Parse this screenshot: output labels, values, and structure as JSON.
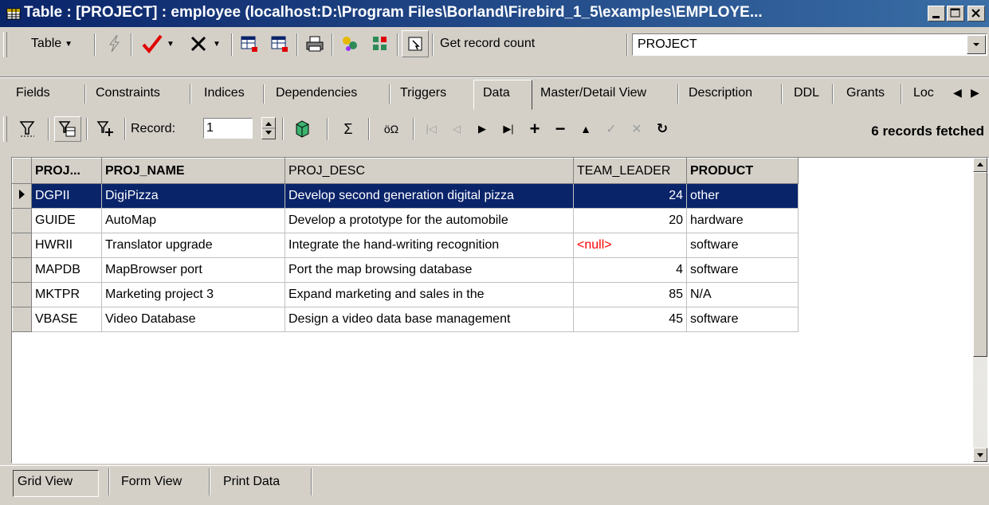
{
  "window": {
    "title": "Table : [PROJECT] : employee (localhost:D:\\Program Files\\Borland\\Firebird_1_5\\examples\\EMPLOYE..."
  },
  "toolbar": {
    "table_menu_label": "Table",
    "get_record_count_label": "Get record count",
    "table_combo_value": "PROJECT"
  },
  "tabs": [
    "Fields",
    "Constraints",
    "Indices",
    "Dependencies",
    "Triggers",
    "Data",
    "Master/Detail View",
    "Description",
    "DDL",
    "Grants",
    "Loc"
  ],
  "active_tab": "Data",
  "nav": {
    "record_label": "Record:",
    "record_value": "1",
    "sigma": "Σ",
    "fetched_status": "6 records fetched"
  },
  "grid": {
    "columns": [
      "PROJ...",
      "PROJ_NAME",
      "PROJ_DESC",
      "TEAM_LEADER",
      "PRODUCT"
    ],
    "rows": [
      [
        "DGPII",
        "DigiPizza",
        "Develop second generation digital pizza",
        "24",
        "other"
      ],
      [
        "GUIDE",
        "AutoMap",
        "Develop a prototype for the automobile",
        "20",
        "hardware"
      ],
      [
        "HWRII",
        "Translator upgrade",
        "Integrate the hand-writing recognition",
        "<null>",
        "software"
      ],
      [
        "MAPDB",
        "MapBrowser port",
        "Port the map browsing database",
        "4",
        "software"
      ],
      [
        "MKTPR",
        "Marketing project 3",
        "Expand marketing and sales in the",
        "85",
        "N/A"
      ],
      [
        "VBASE",
        "Video Database",
        "Design a video data base management",
        "45",
        "software"
      ]
    ],
    "selected_row": 0,
    "null_color": "#ff0000",
    "selection_color": "#0a246a"
  },
  "bottom_tabs": [
    "Grid View",
    "Form View",
    "Print Data"
  ],
  "bottom_active_tab": "Grid View",
  "icons": [
    "table-icon",
    "lightning-icon",
    "commit-checkmark-icon",
    "rollback-x-icon",
    "grid-export-icon",
    "print-icon",
    "filter-icon",
    "sum-icon"
  ]
}
